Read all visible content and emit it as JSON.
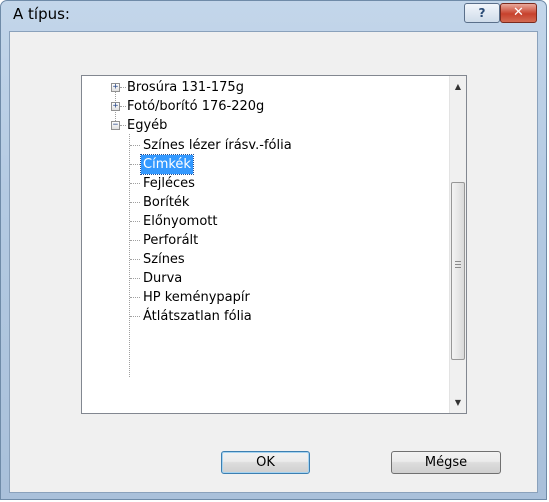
{
  "window": {
    "title": "A típus:",
    "help_glyph": "?",
    "close_glyph": "✕"
  },
  "tree": {
    "items": [
      {
        "label": "Brosúra 131-175g",
        "expander": "+"
      },
      {
        "label": "Fotó/borító 176-220g",
        "expander": "+"
      },
      {
        "label": "Egyéb",
        "expander": "−"
      }
    ],
    "children": [
      {
        "label": "Színes lézer írásv.-fólia"
      },
      {
        "label": "Címkék",
        "selected": true
      },
      {
        "label": "Fejléces"
      },
      {
        "label": "Boríték"
      },
      {
        "label": "Előnyomott"
      },
      {
        "label": "Perforált"
      },
      {
        "label": "Színes"
      },
      {
        "label": "Durva"
      },
      {
        "label": "HP keménypapír"
      },
      {
        "label": "Átlátszatlan fólia"
      }
    ]
  },
  "scrollbar": {
    "up_glyph": "▲",
    "down_glyph": "▼",
    "position": 0.72
  },
  "buttons": {
    "ok_label": "OK",
    "cancel_label": "Mégse"
  },
  "colors": {
    "selection": "#3399ff",
    "close_button": "#c7412c",
    "titlebar": "#b4cae2"
  }
}
